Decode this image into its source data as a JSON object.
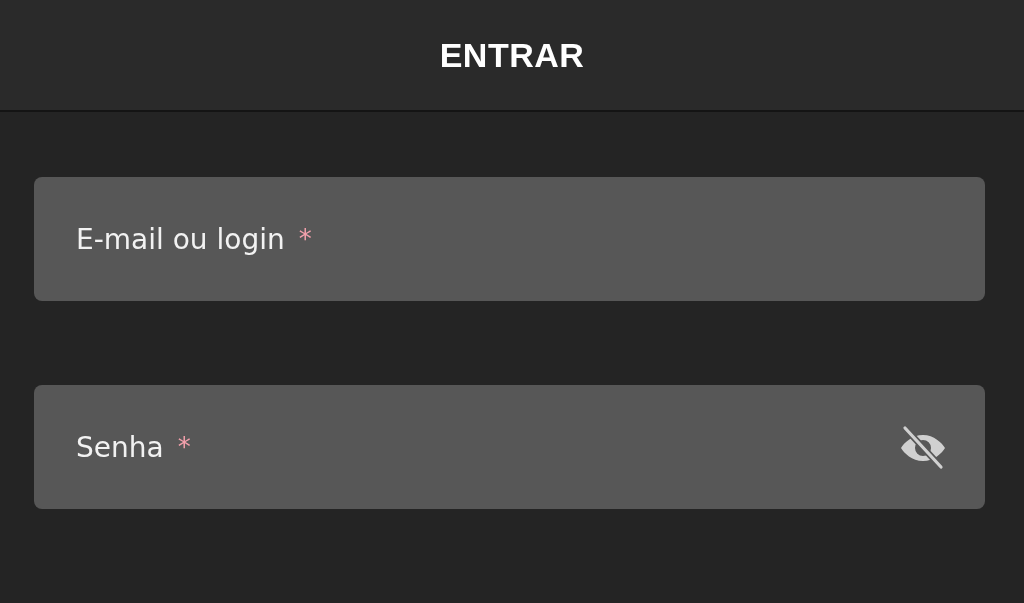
{
  "header": {
    "title": "ENTRAR"
  },
  "fields": [
    {
      "kind": "text",
      "label": "E-mail ou login",
      "required_mark": "*"
    },
    {
      "kind": "password",
      "label": "Senha",
      "required_mark": "*",
      "password_visible": false
    }
  ]
}
